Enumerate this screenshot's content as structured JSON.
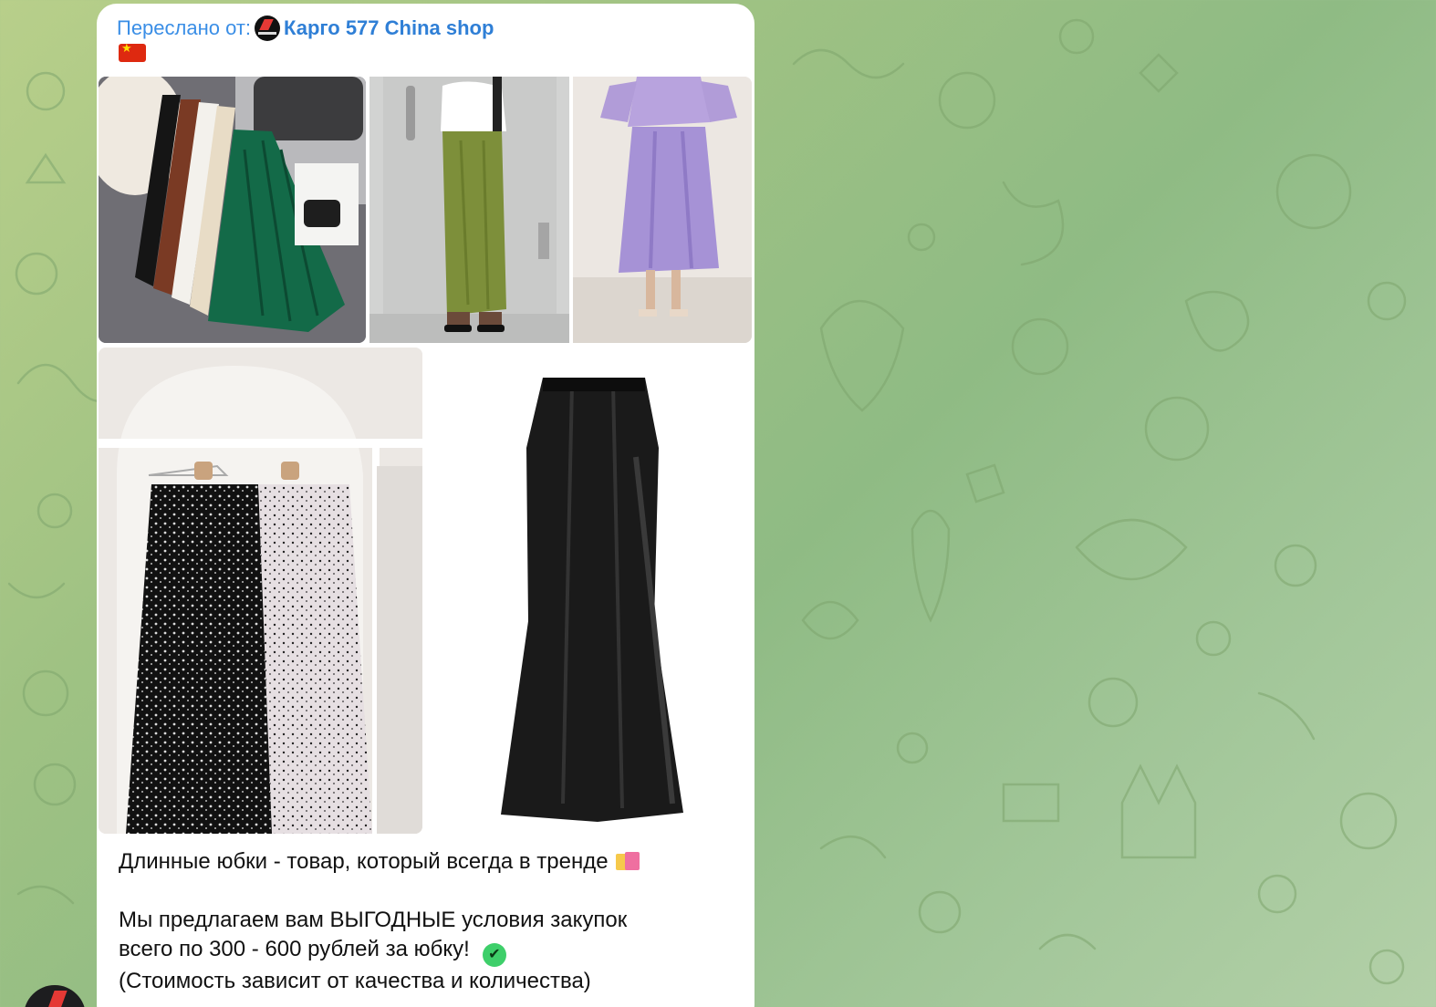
{
  "message": {
    "forward_label": "Переслано от:",
    "channel_name": "Карго 577 China shop",
    "flag_icon": "china-flag-icon",
    "photos": [
      {
        "name": "photo-pleated-skirts"
      },
      {
        "name": "photo-green-satin-skirt"
      },
      {
        "name": "photo-lilac-satin-skirt"
      },
      {
        "name": "photo-polka-dot-skirts"
      },
      {
        "name": "photo-black-satin-skirt"
      }
    ],
    "lines": {
      "line1": "Длинные юбки - товар, который всегда в тренде",
      "line2": "Мы предлагаем вам ВЫГОДНЫЕ условия закупок",
      "line3": "всего по 300 - 600 рублей за юбку!",
      "line4": "(Стоимость зависит от качества и количества)"
    },
    "emoji": {
      "bag": "shopping-bags-icon",
      "check": "check-mark-icon"
    }
  },
  "colors": {
    "link": "#3a8ee6",
    "background_green": "#9fc283",
    "bubble": "#ffffff"
  }
}
